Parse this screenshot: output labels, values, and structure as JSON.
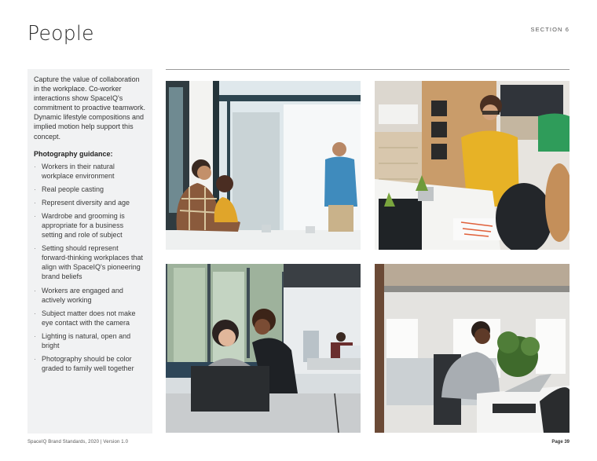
{
  "header": {
    "title": "People",
    "section_label": "SECTION 6"
  },
  "panel": {
    "intro": "Capture the value of collaboration in the workplace. Co-worker interactions show SpaceIQ's commitment to proactive teamwork. Dynamic lifestyle compositions and implied motion help support this concept.",
    "guidance_title": "Photography guidance:",
    "bullet_glyph": "·",
    "guidance_items": [
      "Workers in their natural workplace environment",
      "Real people casting",
      "Represent diversity and age",
      "Wardrobe and grooming is appropriate for a business setting and role of subject",
      "Setting should represent forward-thinking workplaces that align with SpaceIQ's pioneering brand beliefs",
      "Workers are engaged and actively working",
      "Subject matter does not make eye contact with the camera",
      "Lighting is natural, open and bright",
      "Photography should be color graded to family well together"
    ]
  },
  "photos": [
    {
      "name": "meeting-presentation-photo",
      "alt": "Man in blue shirt presenting to seated colleagues by a bright window"
    },
    {
      "name": "woman-yellow-sweater-photo",
      "alt": "Woman in yellow sweater with glasses leading a desk discussion"
    },
    {
      "name": "two-women-laptop-photo",
      "alt": "Two women looking at a laptop together in an open office"
    },
    {
      "name": "woman-at-desk-photo",
      "alt": "Smiling woman in gray turtleneck seated at an office desk"
    }
  ],
  "footer": {
    "left": "SpaceIQ Brand Standards, 2020 | Version 1.0",
    "right": "Page 39"
  }
}
